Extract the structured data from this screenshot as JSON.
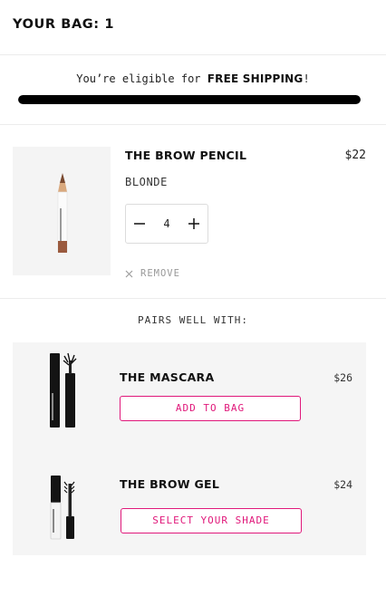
{
  "header": {
    "title": "YOUR BAG: 1"
  },
  "shipping": {
    "prefix": "You’re eligible for ",
    "highlight": "FREE SHIPPING",
    "suffix": "!",
    "progress": 1.0
  },
  "cart_item": {
    "name": "THE BROW PENCIL",
    "price": "$22",
    "shade": "BLONDE",
    "quantity": "4",
    "remove_label": "REMOVE",
    "image_icon": "brow-pencil"
  },
  "pairs": {
    "title": "PAIRS WELL WITH:",
    "items": [
      {
        "name": "THE MASCARA",
        "price": "$26",
        "button": "ADD TO BAG",
        "image_icon": "mascara"
      },
      {
        "name": "THE BROW GEL",
        "price": "$24",
        "button": "SELECT YOUR SHADE",
        "image_icon": "brow-gel"
      }
    ]
  },
  "colors": {
    "accent": "#e0187a",
    "progress_fill": "#000000",
    "divider": "#ececec",
    "panel": "#f5f5f5"
  }
}
